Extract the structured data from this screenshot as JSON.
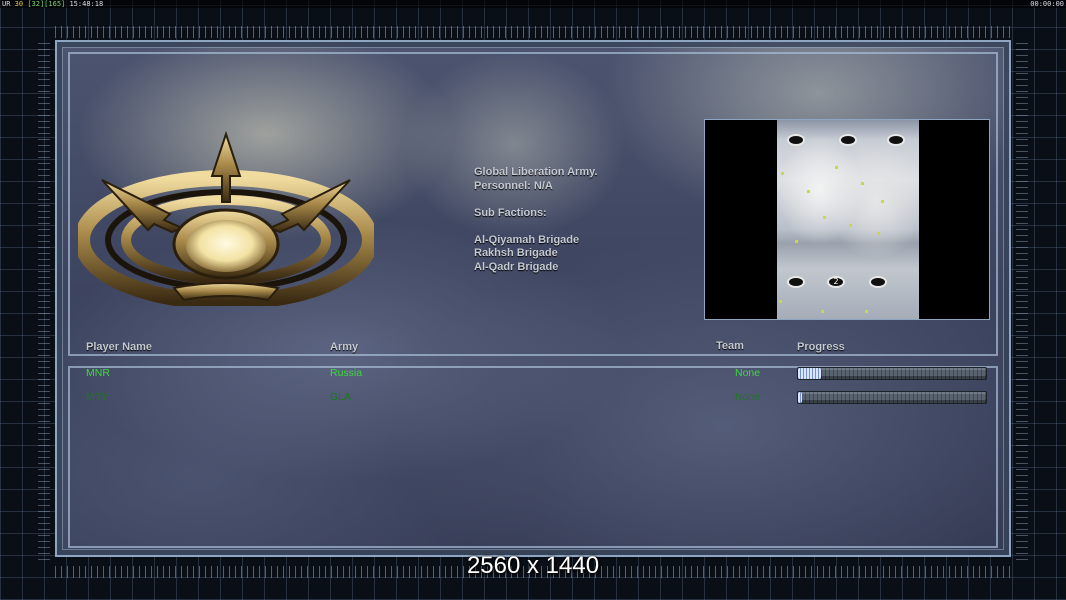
{
  "status_bar": {
    "left_prefix": "UR",
    "fps": "30",
    "bracket_a": "[32]",
    "bracket_b": "[165]",
    "clock": "15:48:18",
    "right_timer": "00:00:00"
  },
  "faction": {
    "name": "Global Liberation Army.",
    "personnel": "Personnel: N/A",
    "sub_factions_heading": "Sub Factions:",
    "sub_factions": [
      "Al-Qiyamah Brigade",
      "Rakhsh Brigade",
      "Al-Qadr Brigade"
    ]
  },
  "minimap": {
    "start_position_label": "2"
  },
  "table": {
    "headers": {
      "player_name": "Player Name",
      "army": "Army",
      "team": "Team",
      "progress": "Progress"
    },
    "rows": [
      {
        "player": "MNR",
        "army": "Russia",
        "team": "None",
        "progress": 0.12
      },
      {
        "player": "MTV",
        "army": "GLA",
        "team": "None",
        "progress": 0.02
      }
    ]
  },
  "colors": {
    "local_player_text": "#3ed83e",
    "remote_player_text": "#1a7a1a",
    "progress_fill": "#6f8fd8",
    "frame_border": "#8fa6c2"
  },
  "resolution_label": "2560 x 1440"
}
